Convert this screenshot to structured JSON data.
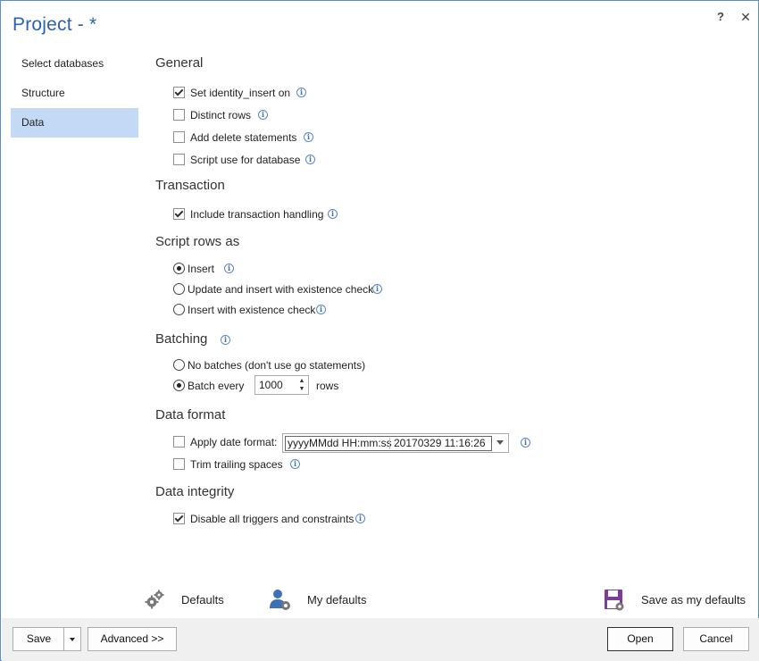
{
  "window": {
    "title": "Project - *",
    "help_label": "?",
    "close_label": "✕"
  },
  "nav": {
    "items": [
      {
        "label": "Select databases"
      },
      {
        "label": "Structure"
      },
      {
        "label": "Data",
        "active": true
      }
    ]
  },
  "sections": {
    "general": {
      "title": "General",
      "options": [
        {
          "label": "Set identity_insert on",
          "checked": true
        },
        {
          "label": "Distinct rows",
          "checked": false
        },
        {
          "label": "Add delete statements",
          "checked": false
        },
        {
          "label": "Script use for database",
          "checked": false
        }
      ]
    },
    "transaction": {
      "title": "Transaction",
      "options": [
        {
          "label": "Include transaction handling",
          "checked": true
        }
      ]
    },
    "script_rows_as": {
      "title": "Script rows as",
      "options": [
        {
          "label": "Insert",
          "selected": true
        },
        {
          "label": "Update and insert with existence check",
          "selected": false
        },
        {
          "label": "Insert with existence check",
          "selected": false
        }
      ]
    },
    "batching": {
      "title": "Batching",
      "no_batches_label": "No batches (don't use go statements)",
      "batch_every_label": "Batch every",
      "batch_size": "1000",
      "rows_label": "rows",
      "selected": "batch_every"
    },
    "data_format": {
      "title": "Data format",
      "apply_date_format_label": "Apply date format:",
      "apply_date_format_checked": false,
      "date_format": "yyyyMMdd HH:mm:ss",
      "date_example": "20170329 11:16:26",
      "trim_trailing_spaces_label": "Trim trailing spaces",
      "trim_trailing_spaces_checked": false
    },
    "data_integrity": {
      "title": "Data integrity",
      "options": [
        {
          "label": "Disable all triggers and constraints",
          "checked": true
        }
      ]
    }
  },
  "defaults_bar": {
    "defaults_label": "Defaults",
    "my_defaults_label": "My defaults",
    "save_as_my_defaults_label": "Save as my defaults"
  },
  "footer": {
    "save_label": "Save",
    "advanced_label": "Advanced >>",
    "open_label": "Open",
    "cancel_label": "Cancel"
  },
  "colors": {
    "accent": "#2b62b0",
    "nav_active": "#c4d9f5",
    "footer_bg": "#f0f0f0"
  }
}
